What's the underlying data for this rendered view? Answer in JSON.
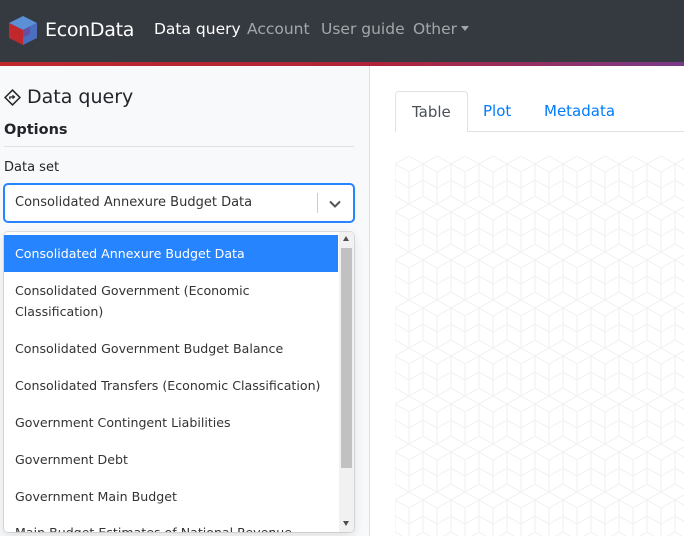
{
  "navbar": {
    "brand": "EconData",
    "items": [
      {
        "label": "Data query",
        "active": true
      },
      {
        "label": "Account",
        "active": false
      },
      {
        "label": "User guide",
        "active": false
      },
      {
        "label": "Other",
        "active": false
      }
    ]
  },
  "sidebar": {
    "title": "Data query",
    "options_heading": "Options",
    "dataset_label": "Data set",
    "dataset_selected": "Consolidated Annexure Budget Data",
    "dropdown_options": [
      "Consolidated Annexure Budget Data",
      "Consolidated Government (Economic Classification)",
      "Consolidated Government Budget Balance",
      "Consolidated Transfers (Economic Classification)",
      "Government Contingent Liabilities",
      "Government Debt",
      "Government Main Budget",
      "Main Budget Estimates of National Revenue"
    ]
  },
  "main": {
    "tabs": [
      {
        "label": "Table",
        "active": true
      },
      {
        "label": "Plot",
        "active": false
      },
      {
        "label": "Metadata",
        "active": false
      }
    ]
  },
  "colors": {
    "navbar_bg": "#343a40",
    "accent_stripe": "#c0282d",
    "select_focus": "#2684ff",
    "tab_link": "#007bff"
  }
}
